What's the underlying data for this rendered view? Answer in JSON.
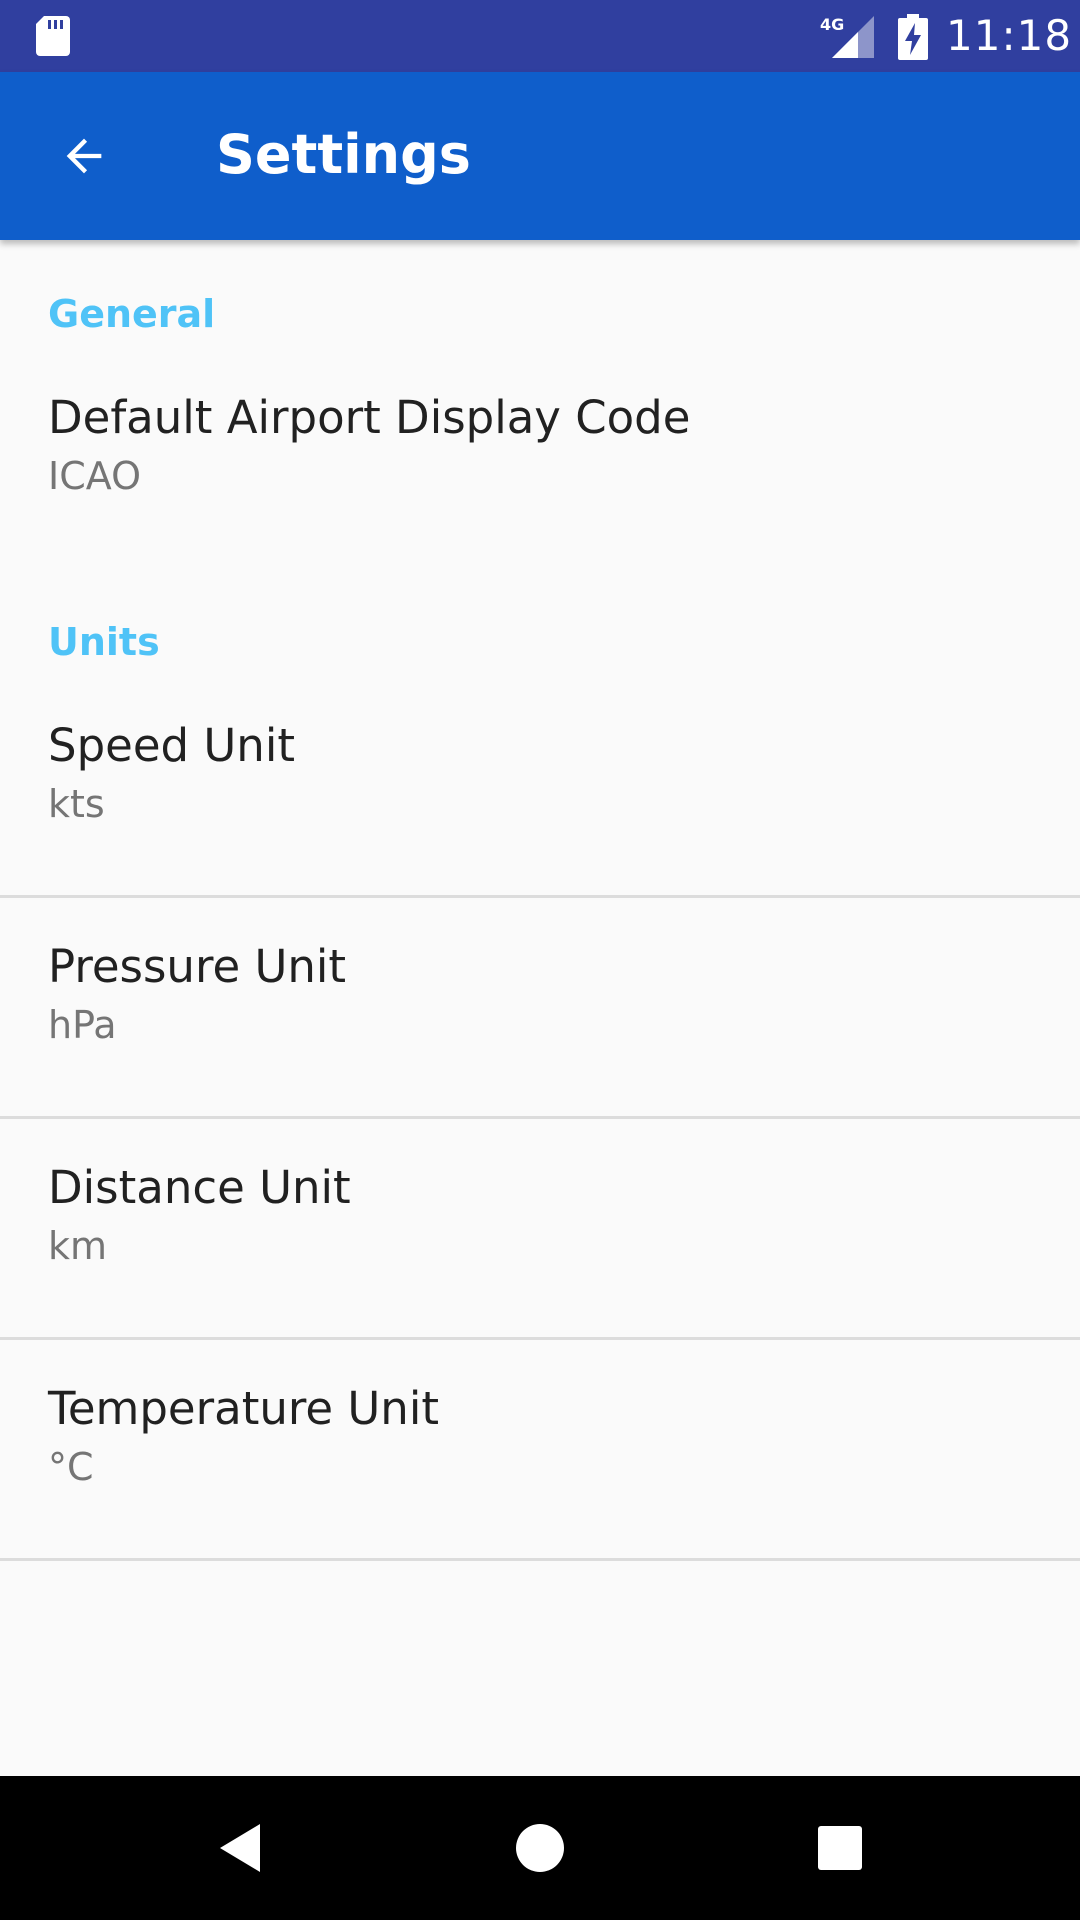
{
  "status_bar": {
    "time": "11:18",
    "network": "4G",
    "icons": [
      "sd-card-icon",
      "signal-icon",
      "battery-charging-icon"
    ]
  },
  "app_bar": {
    "title": "Settings",
    "back_icon": "arrow-back-icon"
  },
  "sections": [
    {
      "header": "General",
      "items": [
        {
          "title": "Default Airport Display Code",
          "summary": "ICAO"
        }
      ]
    },
    {
      "header": "Units",
      "items": [
        {
          "title": "Speed Unit",
          "summary": "kts"
        },
        {
          "title": "Pressure Unit",
          "summary": "hPa"
        },
        {
          "title": "Distance Unit",
          "summary": "km"
        },
        {
          "title": "Temperature Unit",
          "summary": "°C"
        }
      ]
    }
  ],
  "nav_bar": {
    "buttons": [
      "back-triangle-icon",
      "home-circle-icon",
      "recents-square-icon"
    ]
  },
  "colors": {
    "status_bar": "#303f9f",
    "app_bar": "#0f5ecb",
    "category_text": "#4fc3f7",
    "background": "#fafafa"
  }
}
